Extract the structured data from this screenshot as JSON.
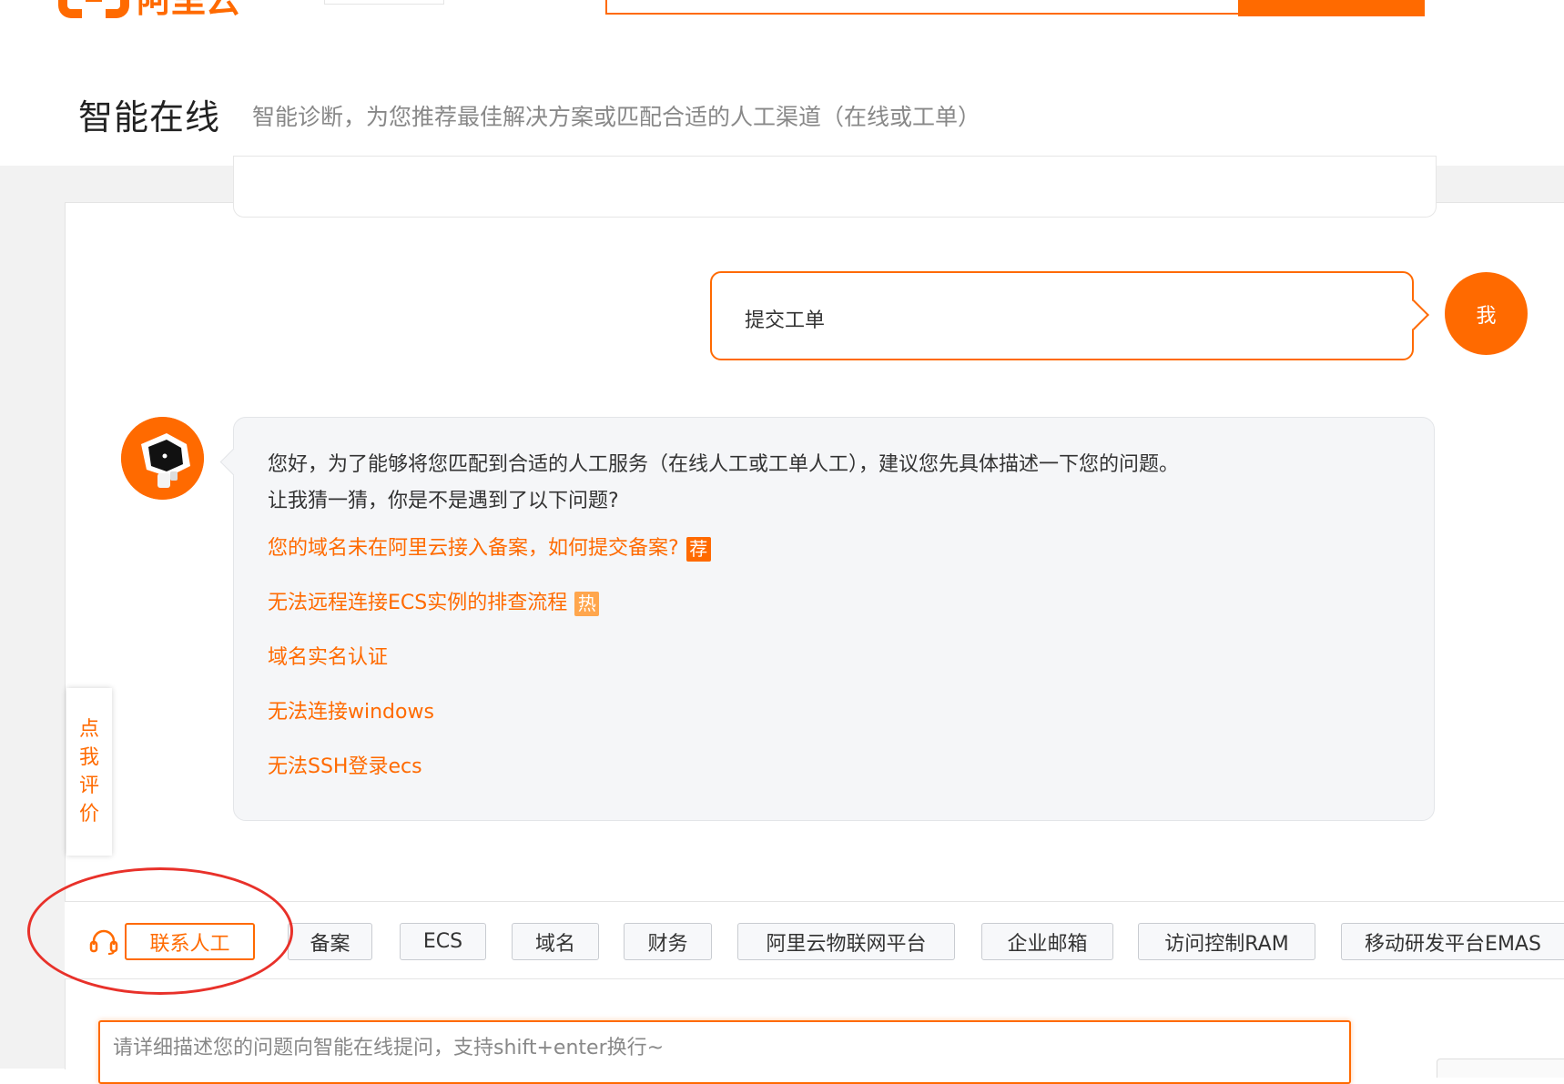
{
  "header": {
    "logo_text": "阿里云",
    "title": "智能在线",
    "subtitle": "智能诊断，为您推荐最佳解决方案或匹配合适的人工渠道（在线或工单）"
  },
  "conversation": {
    "user_message": "提交工单",
    "user_avatar_label": "我",
    "bot_greeting": "您好，为了能够将您匹配到合适的人工服务（在线人工或工单人工），建议您先具体描述一下您的问题。",
    "bot_prompt": "让我猜一猜，你是不是遇到了以下问题?",
    "suggestions": [
      {
        "text": "您的域名未在阿里云接入备案，如何提交备案?",
        "tag": "荐"
      },
      {
        "text": "无法远程连接ECS实例的排查流程",
        "tag": "热"
      },
      {
        "text": "域名实名认证",
        "tag": ""
      },
      {
        "text": "无法连接windows",
        "tag": ""
      },
      {
        "text": "无法SSH登录ecs",
        "tag": ""
      }
    ]
  },
  "rating_tab": [
    "点",
    "我",
    "评",
    "价"
  ],
  "quickbar": {
    "contact_label": "联系人工",
    "tags": [
      "备案",
      "ECS",
      "域名",
      "财务",
      "阿里云物联网平台",
      "企业邮箱",
      "访问控制RAM",
      "移动研发平台EMAS"
    ]
  },
  "input": {
    "placeholder": "请详细描述您的问题向智能在线提问，支持shift+enter换行~",
    "value": ""
  },
  "colors": {
    "accent": "#ff6a00",
    "hot_tag": "#ffa64d",
    "annotation": "#e8312a"
  },
  "icons": {
    "contact": "headset-icon",
    "bot": "robot-avatar-icon"
  }
}
